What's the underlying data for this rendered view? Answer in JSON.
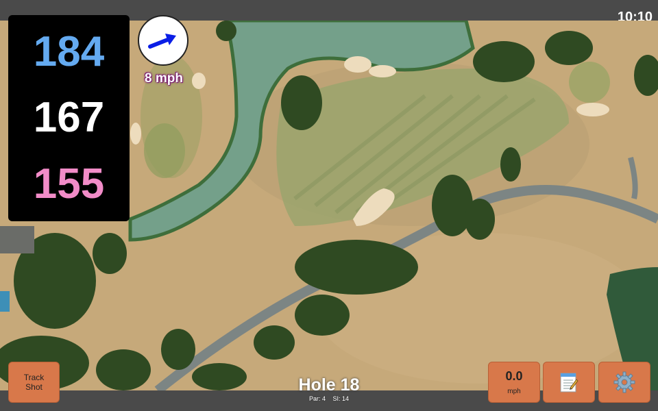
{
  "status": {
    "time": "10:10"
  },
  "distances": {
    "back": "184",
    "middle": "167",
    "front": "155"
  },
  "wind": {
    "speed_label": "8 mph",
    "direction_icon": "arrow-icon",
    "arrow_color": "#0a1ee6"
  },
  "buttons": {
    "track_shot_line1": "Track",
    "track_shot_line2": "Shot",
    "speed_value": "0.0",
    "speed_unit": "mph",
    "notes_icon": "notepad-icon",
    "settings_icon": "gear-icon"
  },
  "hole": {
    "title": "Hole 18",
    "par": "Par: 4",
    "stroke_index": "SI: 14"
  },
  "colors": {
    "back": "#64aaf0",
    "middle": "#ffffff",
    "front": "#f28cc8",
    "button": "#d8784a",
    "water": "#74a08a",
    "fairway": "#9aa36c",
    "bunker": "#eddcbd"
  }
}
